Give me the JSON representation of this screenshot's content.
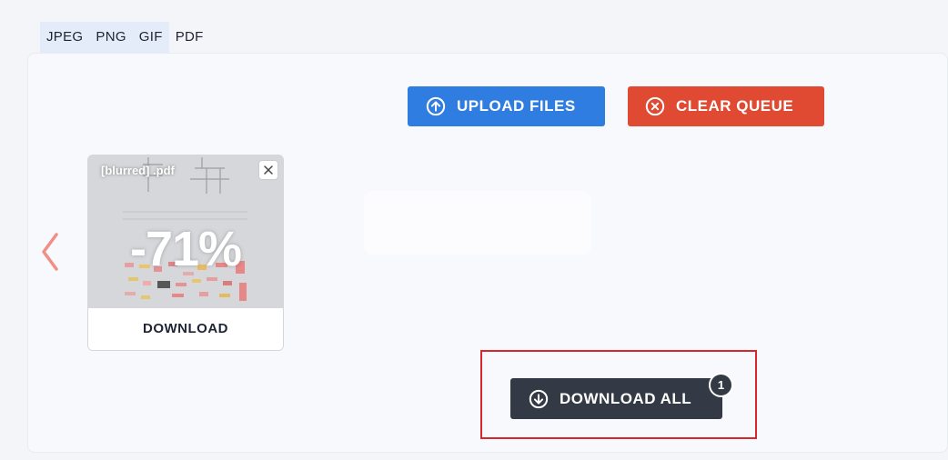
{
  "tabs": [
    {
      "label": "JPEG"
    },
    {
      "label": "PNG"
    },
    {
      "label": "GIF"
    },
    {
      "label": "PDF"
    }
  ],
  "toolbar": {
    "upload_label": "UPLOAD FILES",
    "clear_label": "CLEAR QUEUE"
  },
  "file_card": {
    "filename": "[blurred] .pdf",
    "reduction": "-71%",
    "download_label": "DOWNLOAD"
  },
  "download_all": {
    "label": "DOWNLOAD ALL",
    "count": "1"
  },
  "colors": {
    "upload": "#2f7de1",
    "clear": "#e04a33",
    "download_all": "#333a45",
    "highlight": "#d9272e",
    "nav_arrow": "#f08f85"
  },
  "icons": {
    "upload": "arrow-up-circle-icon",
    "clear": "x-circle-icon",
    "download_all": "arrow-down-circle-icon",
    "prev": "chevron-left-icon",
    "close": "close-icon"
  }
}
